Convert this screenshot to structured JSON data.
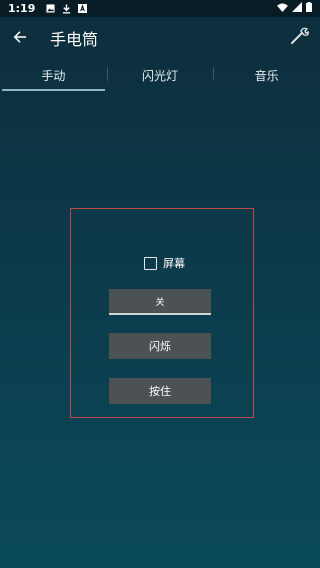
{
  "status": {
    "time": "1:19",
    "left_icons": [
      "image-icon",
      "download-icon",
      "a-badge-icon"
    ],
    "right_icons": [
      "wifi-icon",
      "signal-icon",
      "battery-icon"
    ]
  },
  "toolbar": {
    "title": "手电筒",
    "back_icon": "arrow-left-icon",
    "tool_icon": "wrench-icon"
  },
  "tabs": [
    {
      "label": "手动",
      "active": true
    },
    {
      "label": "闪光灯",
      "active": false
    },
    {
      "label": "音乐",
      "active": false
    }
  ],
  "panel": {
    "checkbox_label": "屏幕",
    "checkbox_checked": false,
    "buttons": {
      "off": "关",
      "flash": "闪烁",
      "hold": "按住"
    }
  },
  "colors": {
    "panel_border": "#c0474a",
    "button_bg": "#4c5154",
    "tab_indicator": "#8ab8c4"
  }
}
